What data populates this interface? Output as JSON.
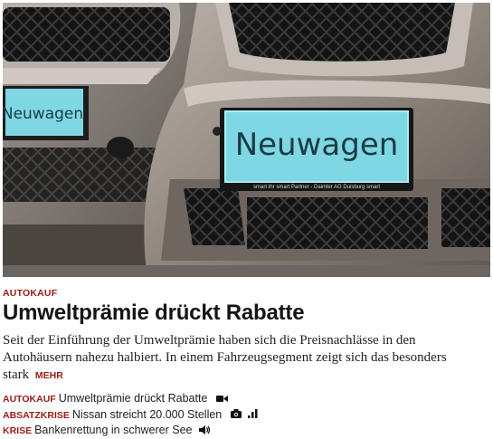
{
  "hero": {
    "plate_left": "Neuwagen",
    "plate_right": "Neuwagen",
    "plate_frame_text": "smart  Ihr smart Partner - Daimler AG Duisburg  smart"
  },
  "article": {
    "kicker": "AUTOKAUF",
    "headline": "Umweltprämie drückt Rabatte",
    "teaser": "Seit der Einführung der Umweltprämie haben sich die Preisnachlässe in den Autohäusern nahezu halbiert. In einem Fahrzeugsegment zeigt sich das besonders stark",
    "more_label": "MEHR"
  },
  "related": [
    {
      "kicker": "AUTOKAUF",
      "title": "Umweltprämie drückt Rabatte",
      "icons": [
        "video-camera-icon"
      ]
    },
    {
      "kicker": "ABSATZKRISE",
      "title": "Nissan streicht 20.000 Stellen",
      "icons": [
        "photo-camera-icon",
        "bar-chart-icon"
      ]
    },
    {
      "kicker": "KRISE",
      "title": "Bankenrettung in schwerer See",
      "icons": [
        "speaker-icon"
      ]
    }
  ],
  "colors": {
    "accent": "#9b1b17",
    "plate": "#7fd7e3"
  }
}
